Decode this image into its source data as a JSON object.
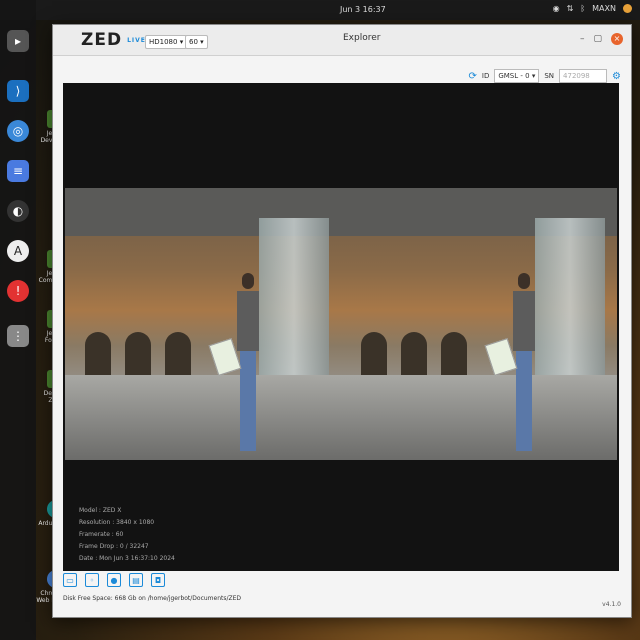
{
  "topbar": {
    "clock": "Jun 3  16:37",
    "user": "MAXN"
  },
  "desktop": {
    "items": [
      "Jetson Developer",
      "Jetson Community",
      "Jetson Forums",
      "Develop Zone",
      "Arduino IDE",
      "Chromium Web Browser"
    ]
  },
  "app": {
    "logo": "ZED",
    "live_badge": "LIVE",
    "window_title": "Explorer",
    "resolution": "HD1080",
    "fps": "60",
    "camera_id_label": "ID",
    "camera_id_value": "GMSL - 0",
    "sn_label": "SN",
    "sn_placeholder": "472098"
  },
  "info": {
    "model": "Model : ZED X",
    "resolution": "Resolution : 3840 x 1080",
    "framerate": "Framerate : 60",
    "frame_drop": "Frame Drop : 0 / 32247",
    "date": "Date : Mon Jun 3 16:37:10 2024"
  },
  "status": {
    "disk": "Disk Free Space: 668 Gb  on /home/jgerbot/Documents/ZED",
    "version": "v4.1.0"
  },
  "colors": {
    "accent": "#1b8ad8",
    "close": "#e8642c"
  }
}
